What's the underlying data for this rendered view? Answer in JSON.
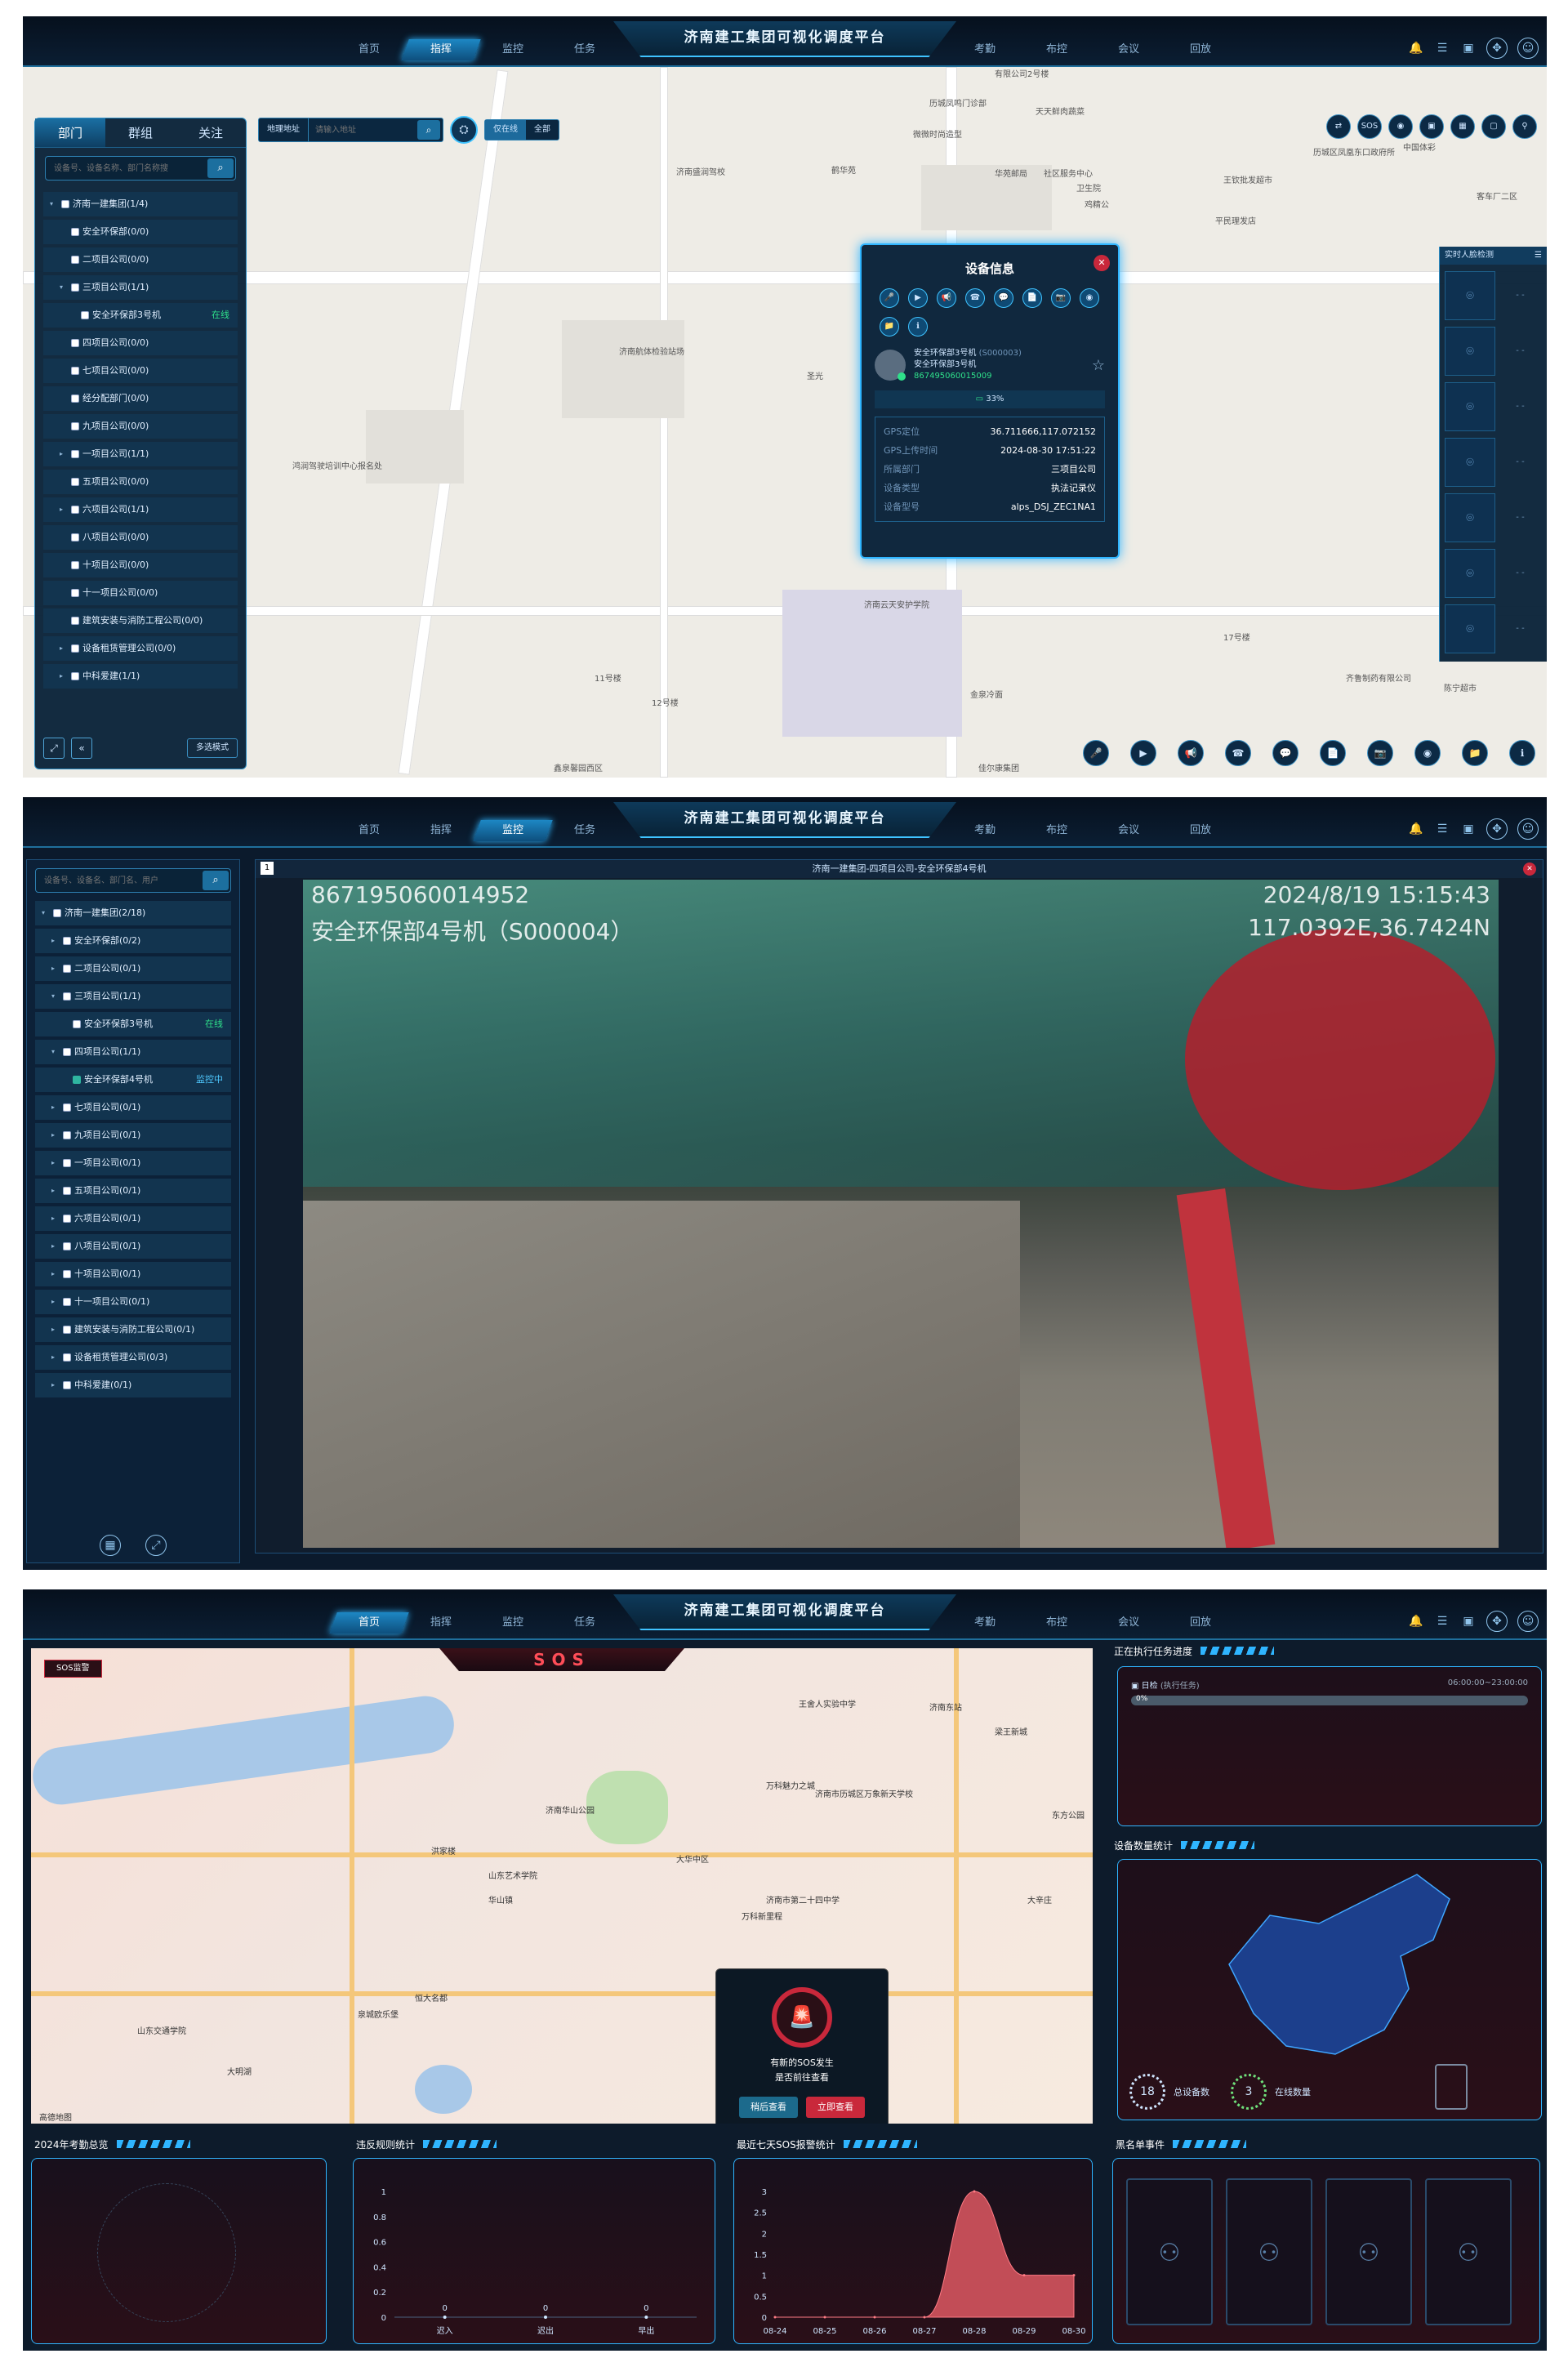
{
  "header": {
    "title": "济南建工集团可视化调度平台"
  },
  "s1": {
    "nav_left": [
      "首页",
      "指挥",
      "监控",
      "任务"
    ],
    "nav_right": [
      "考勤",
      "布控",
      "会议",
      "回放"
    ],
    "active_nav": 1,
    "tabs": [
      "部门",
      "群组",
      "关注"
    ],
    "search_placeholder": "设备号、设备名称、部门名称搜",
    "tree": [
      {
        "label": "济南一建集团(1/4)",
        "arrow": "▾",
        "level": 0
      },
      {
        "label": "安全环保部(0/0)",
        "arrow": "",
        "level": 1
      },
      {
        "label": "二项目公司(0/0)",
        "arrow": "",
        "level": 1
      },
      {
        "label": "三项目公司(1/1)",
        "arrow": "▾",
        "level": 1
      },
      {
        "label": "安全环保部3号机",
        "arrow": "",
        "level": 2,
        "status": "在线"
      },
      {
        "label": "四项目公司(0/0)",
        "arrow": "",
        "level": 1
      },
      {
        "label": "七项目公司(0/0)",
        "arrow": "",
        "level": 1
      },
      {
        "label": "经分配部门(0/0)",
        "arrow": "",
        "level": 1
      },
      {
        "label": "九项目公司(0/0)",
        "arrow": "",
        "level": 1
      },
      {
        "label": "一项目公司(1/1)",
        "arrow": "▸",
        "level": 1
      },
      {
        "label": "五项目公司(0/0)",
        "arrow": "",
        "level": 1
      },
      {
        "label": "六项目公司(1/1)",
        "arrow": "▸",
        "level": 1
      },
      {
        "label": "八项目公司(0/0)",
        "arrow": "",
        "level": 1
      },
      {
        "label": "十项目公司(0/0)",
        "arrow": "",
        "level": 1
      },
      {
        "label": "十一项目公司(0/0)",
        "arrow": "",
        "level": 1
      },
      {
        "label": "建筑安装与消防工程公司(0/0)",
        "arrow": "",
        "level": 1
      },
      {
        "label": "设备租赁管理公司(0/0)",
        "arrow": "▸",
        "level": 1
      },
      {
        "label": "中科爱建(1/1)",
        "arrow": "▸",
        "level": 1
      }
    ],
    "multi_mode": "多选模式",
    "addr_select": "地理地址",
    "addr_placeholder": "请输入地址",
    "toggle": [
      "仅在线",
      "全部"
    ],
    "right_tools": [
      "⇄",
      "SOS",
      "◉",
      "▣",
      "▦",
      "▢",
      "⚲"
    ],
    "bottom_tools": [
      "🎤",
      "▶",
      "📢",
      "☎",
      "💬",
      "📄",
      "📷",
      "◉",
      "📁",
      "ℹ"
    ],
    "device_info": {
      "title": "设备信息",
      "name": "安全环保部3号机",
      "code": "(S000003)",
      "dept_name": "安全环保部3号机",
      "imei": "867495060015009",
      "battery": "33%",
      "rows": [
        {
          "k": "GPS定位",
          "v": "36.711666,117.072152"
        },
        {
          "k": "GPS上传时间",
          "v": "2024-08-30 17:51:22"
        },
        {
          "k": "所属部门",
          "v": "三项目公司"
        },
        {
          "k": "设备类型",
          "v": "执法记录仪"
        },
        {
          "k": "设备型号",
          "v": "alps_DSJ_ZEC1NA1"
        }
      ]
    },
    "realtime_title": "实时人脸检测",
    "map_labels": [
      "有限公司2号楼",
      "历城凤鸣门诊部",
      "天天鲜肉蔬菜",
      "微微时尚造型",
      "济南盛润驾校",
      "鹤华苑",
      "华苑邮局",
      "社区服务中心",
      "鸡精公",
      "卫生院",
      "王钦批发超市",
      "历城区凤凰东口政府所",
      "平民理发店",
      "鸿润驾驶培训中心报名处",
      "济南航体检验站场",
      "圣光",
      "济南云天安护学院",
      "11号楼",
      "12号楼",
      "17号楼",
      "鑫泉馨园西区",
      "金泉冷面",
      "佳尔康集团",
      "齐鲁制药有限公司",
      "陈宁超市",
      "客车厂二区",
      "中国体彩"
    ]
  },
  "s2": {
    "active_nav": 2,
    "search_placeholder": "设备号、设备名、部门名、用户",
    "tree": [
      {
        "label": "济南一建集团(2/18)",
        "arrow": "▾",
        "level": 0
      },
      {
        "label": "安全环保部(0/2)",
        "arrow": "▸",
        "level": 1
      },
      {
        "label": "二项目公司(0/1)",
        "arrow": "▸",
        "level": 1
      },
      {
        "label": "三项目公司(1/1)",
        "arrow": "▾",
        "level": 1
      },
      {
        "label": "安全环保部3号机",
        "arrow": "",
        "level": 2,
        "status": "在线"
      },
      {
        "label": "四项目公司(1/1)",
        "arrow": "▾",
        "level": 1
      },
      {
        "label": "安全环保部4号机",
        "arrow": "",
        "level": 2,
        "status": "监控中",
        "checked": true
      },
      {
        "label": "七项目公司(0/1)",
        "arrow": "▸",
        "level": 1
      },
      {
        "label": "九项目公司(0/1)",
        "arrow": "▸",
        "level": 1
      },
      {
        "label": "一项目公司(0/1)",
        "arrow": "▸",
        "level": 1
      },
      {
        "label": "五项目公司(0/1)",
        "arrow": "▸",
        "level": 1
      },
      {
        "label": "六项目公司(0/1)",
        "arrow": "▸",
        "level": 1
      },
      {
        "label": "八项目公司(0/1)",
        "arrow": "▸",
        "level": 1
      },
      {
        "label": "十项目公司(0/1)",
        "arrow": "▸",
        "level": 1
      },
      {
        "label": "十一项目公司(0/1)",
        "arrow": "▸",
        "level": 1
      },
      {
        "label": "建筑安装与消防工程公司(0/1)",
        "arrow": "▸",
        "level": 1
      },
      {
        "label": "设备租赁管理公司(0/3)",
        "arrow": "▸",
        "level": 1
      },
      {
        "label": "中科爱建(0/1)",
        "arrow": "▸",
        "level": 1
      }
    ],
    "video_num": "1",
    "video_title": "济南一建集团-四项目公司-安全环保部4号机",
    "overlay_id": "867195060014952",
    "overlay_name": "安全环保部4号机（S000004）",
    "overlay_time": "2024/8/19 15:15:43",
    "overlay_gps": "117.0392E,36.7424N"
  },
  "s3": {
    "active_nav": 0,
    "sos_title": "SOS",
    "sos_tag": "SOS监警",
    "sos_popup": {
      "line1": "有新的SOS发生",
      "line2": "是否前往查看",
      "later": "稍后查看",
      "now": "立即查看"
    },
    "task_panel": {
      "title": "正在执行任务进度",
      "task": "日检",
      "task_sub": "(执行任务)",
      "time": "06:00:00~23:00:00",
      "pct": "0%",
      "progress": 0
    },
    "device_stats": {
      "title": "设备数量统计",
      "total": "18",
      "total_label": "总设备数",
      "online": "3",
      "online_label": "在线数量"
    },
    "attendance_title": "2024年考勤总览",
    "violation_title": "违反规则统计",
    "sos7_title": "最近七天SOS报警统计",
    "blacklist_title": "黑名单事件",
    "map_labels": [
      "王舍人实验中学",
      "济南东站",
      "梁王新城",
      "万科魅力之城",
      "济南市历城区万象新天学校",
      "东方公园",
      "山东艺术学院",
      "大华中区",
      "济南市第二十四中学",
      "万科新里程",
      "大辛庄",
      "华山镇",
      "济南华山公园",
      "洪家楼",
      "山东交通学院",
      "大明湖",
      "恒大名都",
      "泉城欧乐堡",
      "高德地图"
    ]
  },
  "chart_data": [
    {
      "type": "line",
      "title": "违反规则统计",
      "categories": [
        "迟入",
        "迟出",
        "早出"
      ],
      "values": [
        0,
        0,
        0
      ],
      "ylim": [
        0,
        1
      ],
      "yticks": [
        "0",
        "0.2",
        "0.4",
        "0.6",
        "0.8",
        "1"
      ]
    },
    {
      "type": "area",
      "title": "最近七天SOS报警统计",
      "categories": [
        "08-24",
        "08-25",
        "08-26",
        "08-27",
        "08-28",
        "08-29",
        "08-30"
      ],
      "values": [
        0,
        0,
        0,
        0,
        3,
        1,
        1
      ],
      "ylim": [
        0,
        3
      ],
      "yticks": [
        "0",
        "0.5",
        "1",
        "1.5",
        "2",
        "2.5",
        "3"
      ]
    }
  ]
}
